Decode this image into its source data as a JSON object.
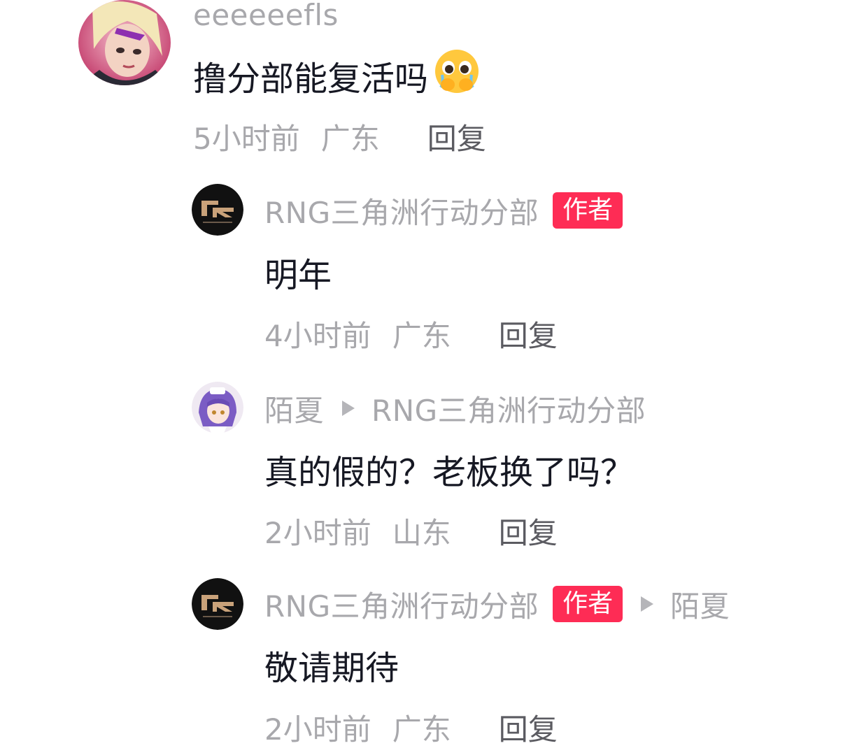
{
  "comments": [
    {
      "username": "eeeeeefls",
      "text": "撸分部能复活吗",
      "emoji": "pleading-face-emoji",
      "time": "5小时前",
      "location": "广东",
      "reply_label": "回复"
    },
    {
      "username": "RNG三角洲行动分部",
      "badge": "作者",
      "text": "明年",
      "time": "4小时前",
      "location": "广东",
      "reply_label": "回复"
    },
    {
      "username": "陌夏",
      "reply_to": "RNG三角洲行动分部",
      "text": "真的假的？老板换了吗？",
      "time": "2小时前",
      "location": "山东",
      "reply_label": "回复"
    },
    {
      "username": "RNG三角洲行动分部",
      "badge": "作者",
      "reply_to": "陌夏",
      "text": "敬请期待",
      "time": "2小时前",
      "location": "广东",
      "reply_label": "回复"
    }
  ],
  "colors": {
    "badge": "#fe2c55",
    "meta_text": "#a8a8ac",
    "reply_button": "#5b5b61",
    "content_text": "#161823"
  }
}
